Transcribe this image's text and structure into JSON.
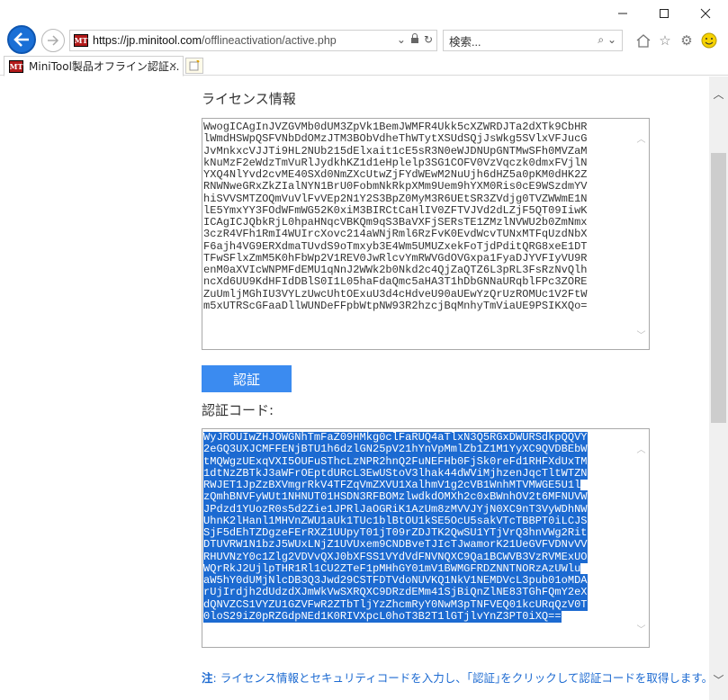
{
  "browser": {
    "url_domain": "https://jp.minitool.com",
    "url_path": "/offlineactivation/active.php",
    "search_placeholder": "検索...",
    "tab_title": "MiniTool製品オフライン認証...",
    "favicon_text": "MT"
  },
  "page": {
    "license_heading": "ライセンス情報",
    "license_lines": [
      "WwogICAgInJVZGVMb0dUM3ZpVk1BemJWMFR4Ukk5cXZWRDJTa2dXTk9CbHR",
      "lWmdHSWpQSFVNbDdOMzJTM3BObVdheThWTytXSUdSQjJsWkg5SVlxVFJucG",
      "JvMnkxcVJJTi9HL2NUb215dElxait1cE5sR3N0eWJDNUpGNTMwSFh0MVZaM",
      "kNuMzF2eWdzTmVuRlJydkhKZ1d1eHplelp3SG1COFV0VzVqczk0dmxFVjlN",
      "YXQ4NlYvd2cvME40SXd0NmZXcUtwZjFYdWEwM2NuUjh6dHZ5a0pKM0dHK2Z",
      "RNWNweGRxZkZIalNYN1BrU0FobmNkRkpXMm9Uem9hYXM0Ris0cE9WSzdmYV",
      "hiSVVSMTZOQmVuVlFvVEp2N1Y2S3BpZ0MyM3R6UEtSR3ZVdjg0TVZWWmE1N",
      "lE5YmxYY3FOdWFmWG52K0xiM3BIRCtCaHlIV0ZFTVJVd2dLZjF5QT09IiwK",
      "ICAgICJQbkRjL0hpaHNqcVBKQm9qS3BaVXFjSERsTE1ZMzlNVWU2b0ZmNmx",
      "3czR4VFh1RmI4WUIrcXovc214aWNjRml6RzFvK0EvdWcvTUNxMTFqUzdNbX",
      "F6ajh4VG9ERXdmaTUvdS9oTmxyb3E4Wm5UMUZxekFoTjdPditQRG8xeE1DT",
      "TFwSFlxZmM5K0hFbWp2V1REV0JwRlcvYmRWVGdOVGxpa1FyaDJYVFIyVU9R",
      "enM0aXVIcWNPMFdEMU1qNnJ2WWk2b0Nkd2c4QjZaQTZ6L3pRL3FsRzNvQlh",
      "ncXd6UU9KdHFIdDBlS0I1L05haFdaQmc5aHA3T1hDbGNNaURqblFPc3ZORE",
      "ZuUmljMGhIU3VYLzUwcUhtOExuU3d4cHdveU90aUEwYzQrUzROMUc1V2FtW",
      "m5xUTRScGFaaDllWUNDeFFpbWtpNW93R2hzcjBqMnhyTmViaUE9PSIKXQo="
    ],
    "activate_button": "認証",
    "auth_heading": "認証コード:",
    "auth_lines": [
      "WyJROUIwZHJOWGNhTmFaZ09HMkg0clFaRUQ4aTlxN3Q5RGxDWURSdkpQQVY",
      "2eGQ3UXJCMFFENjBTU1h6dzlGN25pV21hYnVpMmlZb1Z1M1YyXC9QVDBEbW",
      "tMQWgzUExqVXI5OUFuSThcLzNPR2hnQ2FuNEFHb0FjSk0reFd1RHFXdUxTM",
      "1dtNzZBTkJ3aWFrOEptdURcL3EwUStoV3lhak44dWViMjhzenJqcTltWTZN",
      "RWJET1JpZzBXVmgrRkV4TFZqVmZXVU1XalhmV1g2cVB1WnhMTVMWGE5U1l",
      "zQmhBNVFyWUt1NHNUT01HSDN3RFBOMzlwdkdOMXh2c0xBWnhOV2t6MFNUVW",
      "JPdzd1YUozR0s5d2Zie1JPRlJaOGRiK1AzUm8zMVVJYjN0XC9nT3VyWDhNW",
      "UhnK2lHanl1MHVnZWU1aUk1TUc1blBtOU1kSE5OcU5sakVTcTBBPT0iLCJS",
      "SjF5dEhTZDgzeFErRXZ1UUpyT01jT09rZDJTK2QwSU1YTjVrQ3hnVWg2Rit",
      "DTUVRW1N1bzJ5WUxLNjZ1UVUxem9CNDBveTJIcTJwamorK21UeGVFVDNvVV",
      "RHUVNzY0c1Zlg2VDVvQXJ0bXFSS1VYdVdFNVNQXC9Qa1BCWVB3VzRVMExUO",
      "WQrRkJ2UjlpTHR1Rl1CU2ZTeF1pMHhGY01mV1BWMGFRDZNNTNORzAzUWlu",
      "aW5hY0dUMjNlcDB3Q3Jwd29CSTFDTVdoNUVKQ1NkV1NEMDVcL3pub01oMDA",
      "rUjIrdjh2dUdzdXJmWkVwSXRQXC9DRzdEMm41SjBiQnZlNE83TGhFQmY2eX",
      "dQNVZCS1VYZU1GZVFwR2ZTbTljYzZhcmRyY0NwM3pTNFVEQ01kcURqQzV0T",
      "0loS29iZ0pRZGdpNEd1K0RIVXpcL0hoT3B2T1lGTjlvYnZ3PT0iXQ=="
    ],
    "note_label": "注",
    "note_text": ": ライセンス情報とセキュリティコードを入力し、｢認証｣をクリックして認証コードを取得します。"
  },
  "colors": {
    "accent": "#1c6ad1",
    "button": "#3b8bf0",
    "selection": "#1c6ad1"
  }
}
